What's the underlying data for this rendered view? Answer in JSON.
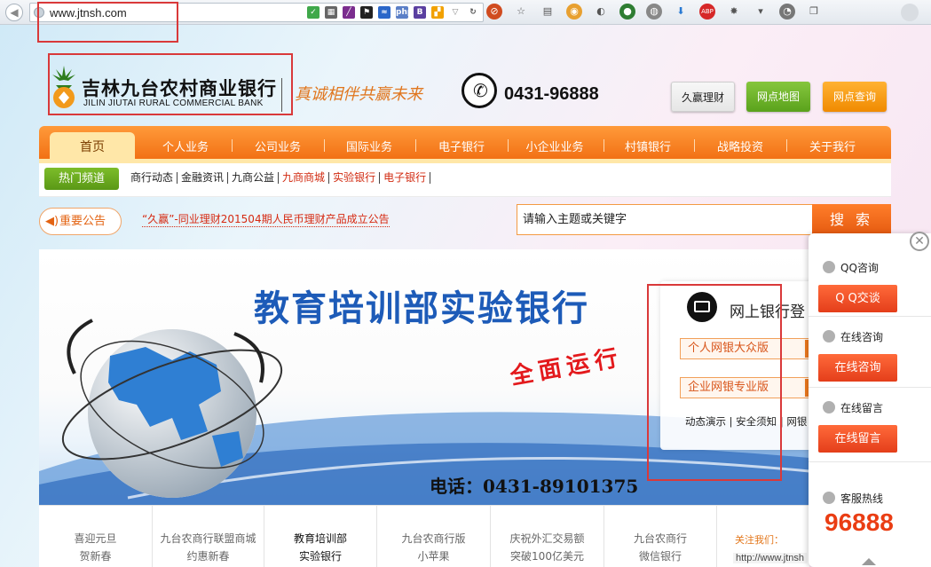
{
  "browser": {
    "url": "www.jtnsh.com",
    "ext_php": "php",
    "ext_b": "B",
    "ext_abp": "ABP"
  },
  "header": {
    "bank_name": "吉林九台农村商业银行",
    "bank_name_en": "JILIN JIUTAI RURAL COMMERCIAL BANK",
    "slogan": "真诚相伴共赢未来",
    "phone": "0431-96888",
    "btn_licai": "久赢理财",
    "btn_map": "网点地图",
    "btn_query": "网点查询"
  },
  "nav": {
    "home": "首页",
    "items": [
      "个人业务",
      "公司业务",
      "国际业务",
      "电子银行",
      "小企业业务",
      "村镇银行",
      "战略投资",
      "关于我行"
    ]
  },
  "subnav": {
    "hot": "热门频道",
    "links": [
      "商行动态",
      "金融资讯",
      "九商公益",
      "九商商城",
      "实验银行",
      "电子银行"
    ]
  },
  "notice": {
    "badge": "重要公告",
    "text": "“久赢”-同业理财201504期人民币理财产品成立公告"
  },
  "search": {
    "placeholder": "请输入主题或关键字",
    "button": "搜 索"
  },
  "banner": {
    "title": "教育培训部实验银行",
    "subtitle": "全面运行",
    "phone": "电话：0431-89101375"
  },
  "ebank": {
    "title": "网上银行登",
    "personal": "个人网银大众版",
    "corporate": "企业网银专业版",
    "links": "动态演示 | 安全须知 | 网银"
  },
  "tiles": [
    {
      "line1": "喜迎元旦",
      "line2": "贺新春"
    },
    {
      "line1": "九台农商行联盟商城",
      "line2": "约惠新春"
    },
    {
      "line1": "教育培训部",
      "line2": "实验银行"
    },
    {
      "line1": "九台农商行版",
      "line2": "小苹果"
    },
    {
      "line1": "庆祝外汇交易额",
      "line2": "突破100亿美元"
    },
    {
      "line1": "九台农商行",
      "line2": "微信银行"
    }
  ],
  "follow": {
    "label": "关注我们：",
    "url": "http://www.jtnsh"
  },
  "side": {
    "close": "✕",
    "qq_head": "QQ咨询",
    "qq_btn": "Q Q交谈",
    "online_head": "在线咨询",
    "online_btn": "在线咨询",
    "msg_head": "在线留言",
    "msg_btn": "在线留言",
    "hotline_head": "客服热线",
    "hotline_num": "96888"
  },
  "colors": {
    "nav_orange": "#f06b10",
    "accent_green": "#5aa21c",
    "annotation_red": "#d9393a"
  }
}
